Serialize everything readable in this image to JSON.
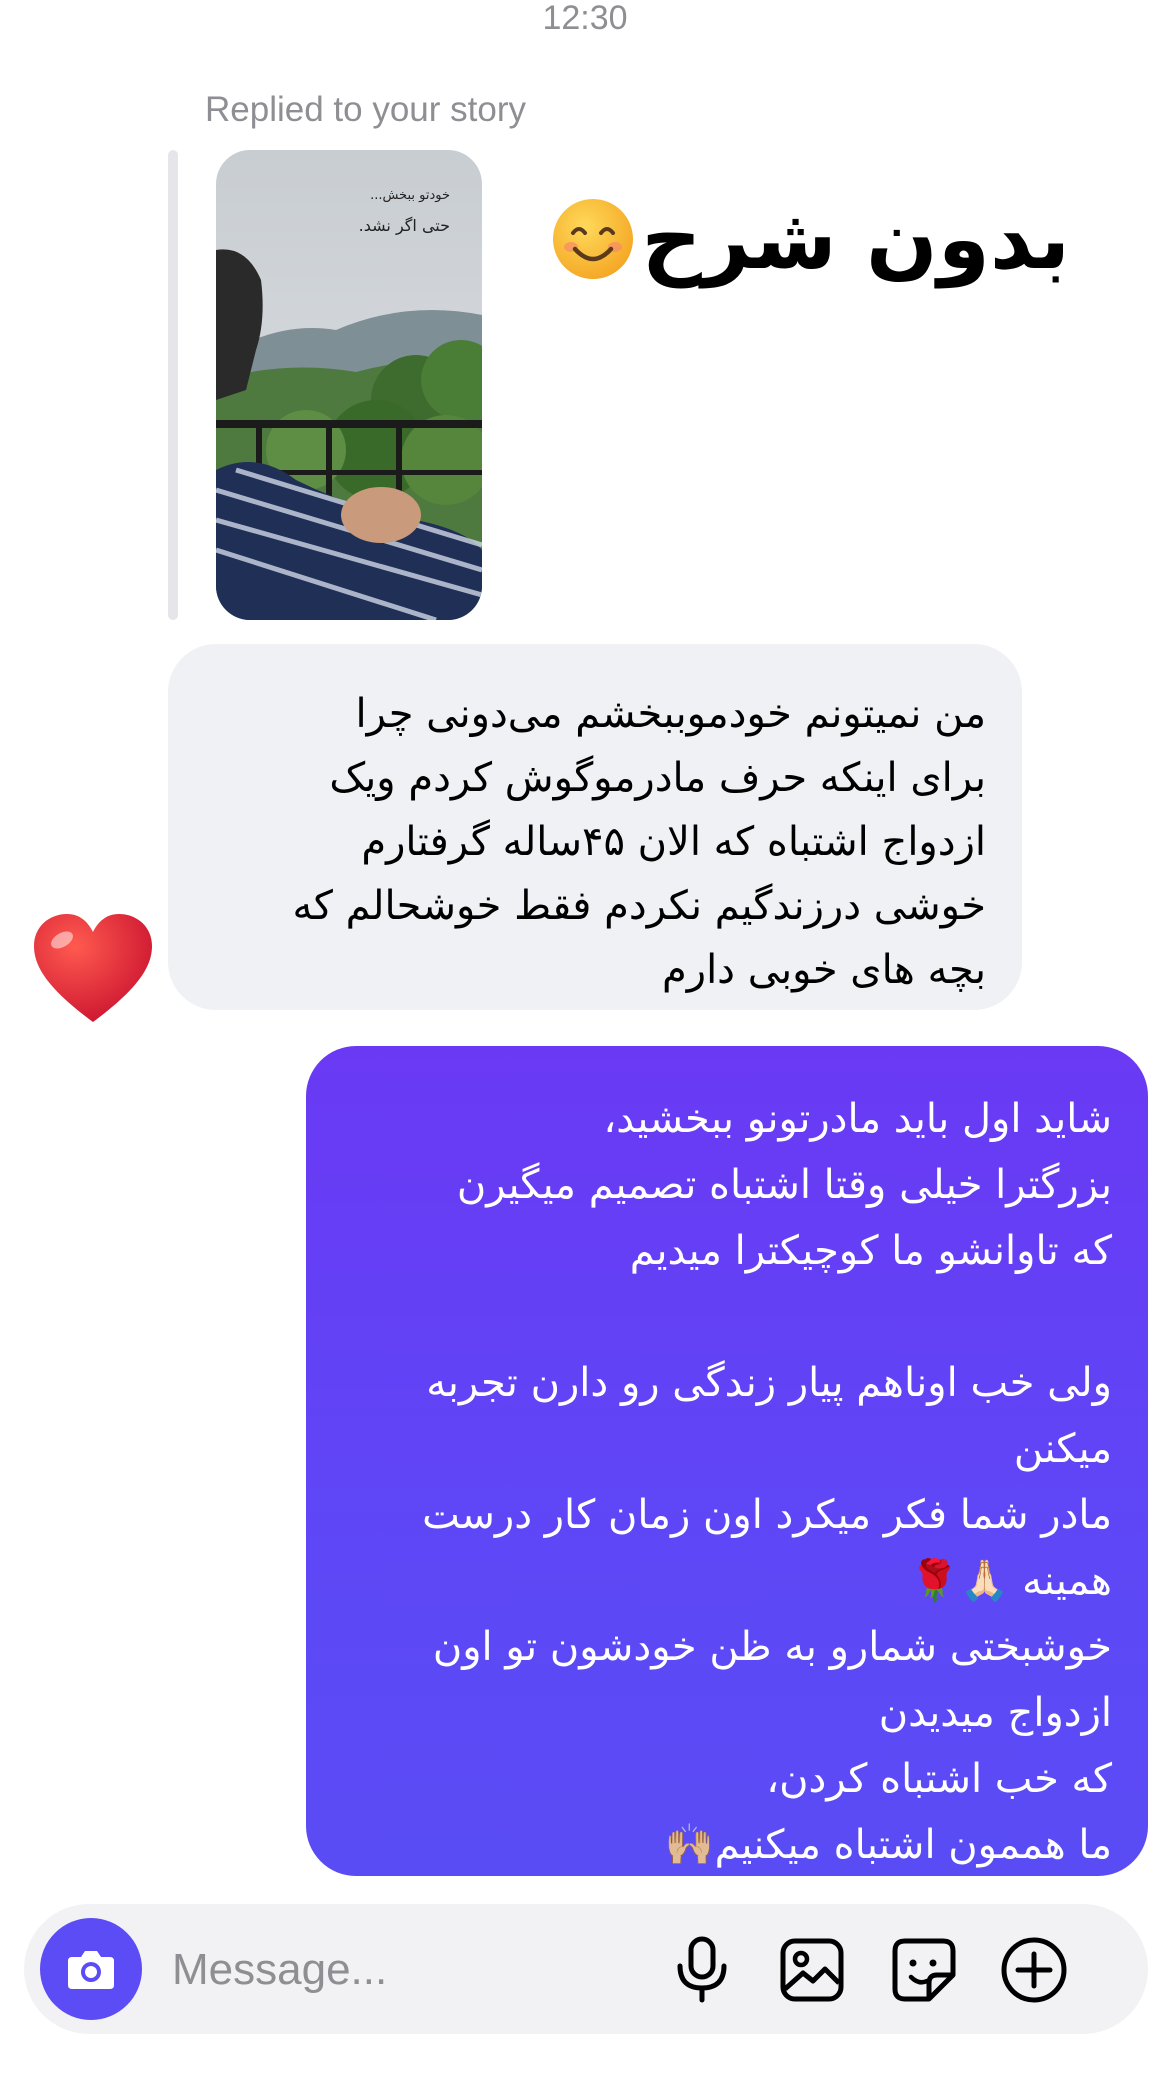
{
  "header": {
    "time": "12:30"
  },
  "reply": {
    "label": "Replied to your story",
    "story_overlay_line1": "خودتو ببخش...",
    "story_overlay_line2": "حتی اگر نشد.",
    "caption_text": "بدون شرح",
    "caption_emoji": "smiling-face-emoji"
  },
  "messages": {
    "incoming": {
      "text": "من نمیتونم خودموببخشم می‌دونی چرا\nبرای اینکه حرف مادرموگوش کردم ویک\nازدواج اشتباه که الان ۴۵ساله گرفتارم\nخوشی درزندگیم نکردم فقط خوشحالم که\nبچه های خوبی دارم",
      "reaction": "red-heart-emoji"
    },
    "outgoing": {
      "text": "شاید اول باید مادرتونو ببخشید،\nبزرگترا خیلی وقتا اشتباه تصمیم میگیرن\nکه تاوانشو ما کوچیکترا میدیم\n\nولی خب اوناهم پیار زندگی رو دارن تجربه\nمیکنن\nمادر شما فکر میکرد اون زمان کار درست\nهمینه 🙏🏻🌹\nخوشبختی  شمارو به ظن خودشون تو اون\nازدواج میدیدن\nکه خب اشتباه کردن،\nما هممون اشتباه میکنیم🙌🏼",
      "color": "#5e47f6"
    }
  },
  "composer": {
    "placeholder": "Message...",
    "icons": [
      "camera-icon",
      "microphone-icon",
      "gallery-icon",
      "sticker-icon",
      "add-icon"
    ],
    "accent": "#5b4cf5"
  }
}
